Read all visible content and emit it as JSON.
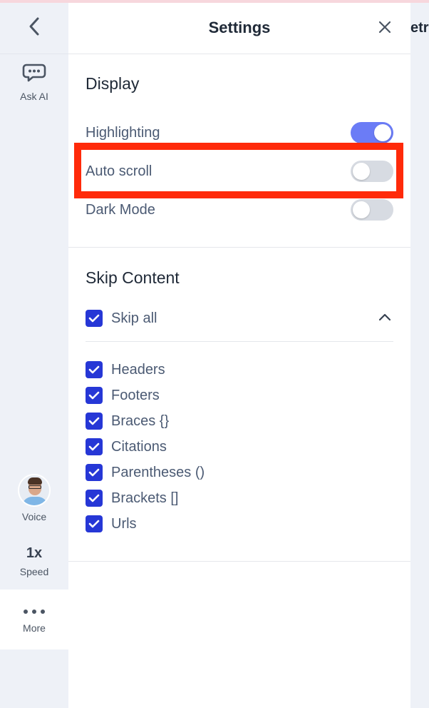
{
  "rail": {
    "ask_ai_label": "Ask AI",
    "voice_label": "Voice",
    "speed_value": "1x",
    "speed_label": "Speed",
    "more_label": "More"
  },
  "panel": {
    "title": "Settings",
    "peek_text": "etr"
  },
  "display": {
    "title": "Display",
    "items": [
      {
        "label": "Highlighting",
        "on": true
      },
      {
        "label": "Auto scroll",
        "on": false
      },
      {
        "label": "Dark Mode",
        "on": false
      }
    ]
  },
  "skip": {
    "title": "Skip Content",
    "skip_all_label": "Skip all",
    "items": [
      {
        "label": "Headers",
        "checked": true
      },
      {
        "label": "Footers",
        "checked": true
      },
      {
        "label": "Braces {}",
        "checked": true
      },
      {
        "label": "Citations",
        "checked": true
      },
      {
        "label": "Parentheses ()",
        "checked": true
      },
      {
        "label": "Brackets []",
        "checked": true
      },
      {
        "label": "Urls",
        "checked": true
      }
    ]
  },
  "colors": {
    "accent": "#2637d6",
    "toggle_on": "#6b7cf6",
    "highlight": "#ff2a0a"
  }
}
